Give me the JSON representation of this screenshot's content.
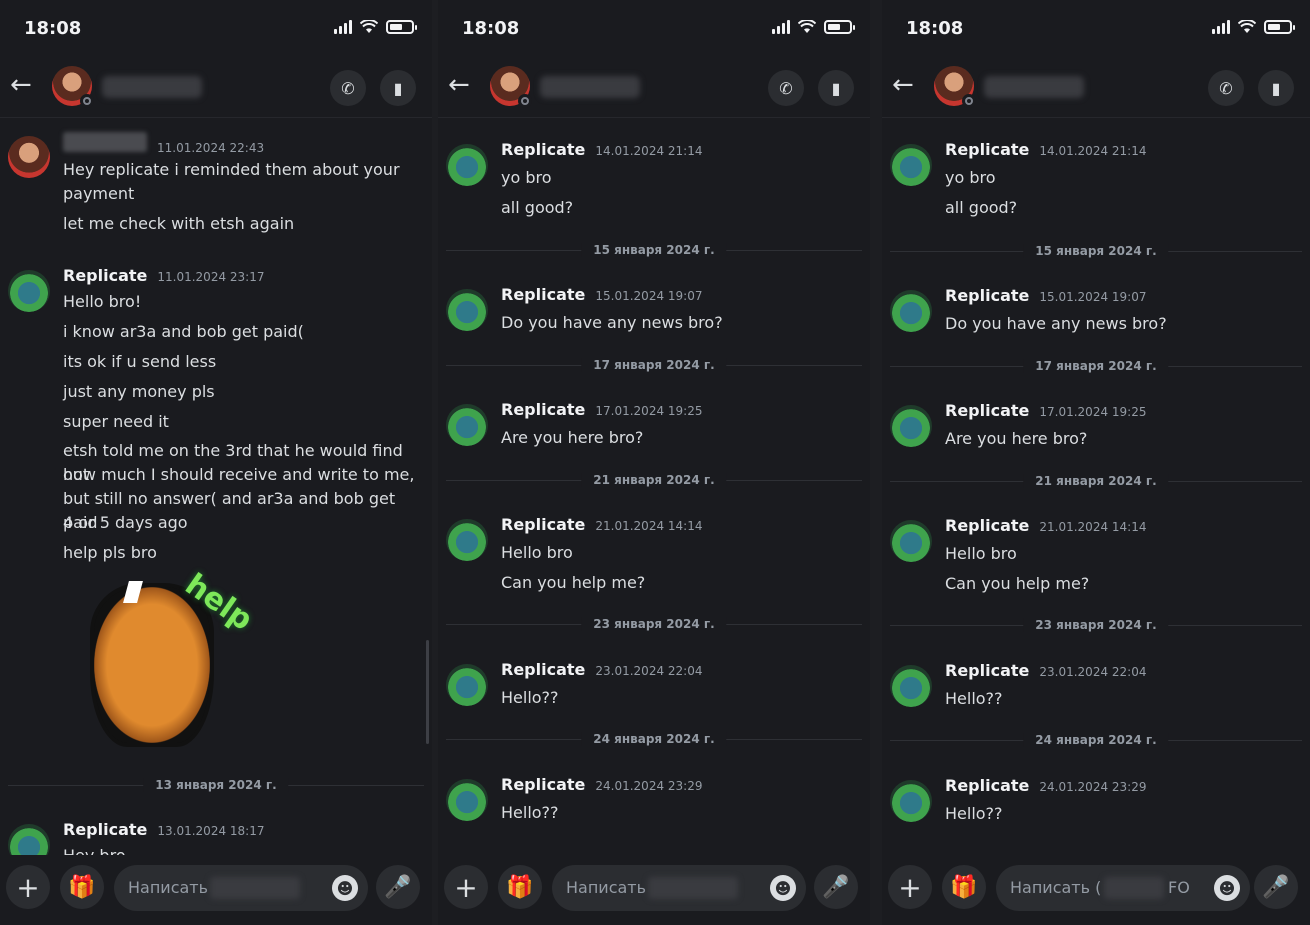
{
  "status_time": "18:08",
  "panel0": {
    "messages": [
      {
        "author": "",
        "timestamp": "11.01.2024 22:43",
        "lines": [
          "Hey replicate i reminded them about your",
          "payment",
          "let me check with etsh again"
        ]
      },
      {
        "author": "Replicate",
        "timestamp": "11.01.2024 23:17",
        "lines": [
          "Hello bro!",
          "i know ar3a and bob get paid(",
          "its ok if u send less",
          "just any money pls",
          "super need it",
          "etsh told me on the 3rd that he would find out",
          "how much I should receive and write to me,",
          "but still no answer( and ar3a and bob get paid",
          "4 or 5 days ago",
          "help pls bro"
        ]
      },
      {
        "author": "Replicate",
        "timestamp": "13.01.2024 18:17",
        "lines": [
          "Hey bro"
        ]
      }
    ],
    "sticker_text": "help",
    "divider": "13 января 2024 г.",
    "composer_placeholder": "Написать"
  },
  "panel1": {
    "messages": [
      {
        "author": "Replicate",
        "timestamp": "14.01.2024 21:14",
        "lines": [
          "yo bro",
          "all good?"
        ]
      },
      {
        "author": "Replicate",
        "timestamp": "15.01.2024 19:07",
        "lines": [
          "Do you have any news bro?"
        ]
      },
      {
        "author": "Replicate",
        "timestamp": "17.01.2024 19:25",
        "lines": [
          "Are you here bro?"
        ]
      },
      {
        "author": "Replicate",
        "timestamp": "21.01.2024 14:14",
        "lines": [
          "Hello bro",
          "Can you help me?"
        ]
      },
      {
        "author": "Replicate",
        "timestamp": "23.01.2024 22:04",
        "lines": [
          "Hello??"
        ]
      },
      {
        "author": "Replicate",
        "timestamp": "24.01.2024 23:29",
        "lines": [
          "Hello??"
        ]
      }
    ],
    "dividers": [
      "15 января 2024 г.",
      "17 января 2024 г.",
      "21 января 2024 г.",
      "23 января 2024 г.",
      "24 января 2024 г."
    ],
    "composer_placeholder": "Написать"
  },
  "panel2": {
    "messages": [
      {
        "author": "Replicate",
        "timestamp": "14.01.2024 21:14",
        "lines": [
          "yo bro",
          "all good?"
        ]
      },
      {
        "author": "Replicate",
        "timestamp": "15.01.2024 19:07",
        "lines": [
          "Do you have any news bro?"
        ]
      },
      {
        "author": "Replicate",
        "timestamp": "17.01.2024 19:25",
        "lines": [
          "Are you here bro?"
        ]
      },
      {
        "author": "Replicate",
        "timestamp": "21.01.2024 14:14",
        "lines": [
          "Hello bro",
          "Can you help me?"
        ]
      },
      {
        "author": "Replicate",
        "timestamp": "23.01.2024 22:04",
        "lines": [
          "Hello??"
        ]
      },
      {
        "author": "Replicate",
        "timestamp": "24.01.2024 23:29",
        "lines": [
          "Hello??"
        ]
      }
    ],
    "dividers": [
      "15 января 2024 г.",
      "17 января 2024 г.",
      "21 января 2024 г.",
      "23 января 2024 г.",
      "24 января 2024 г."
    ],
    "composer_placeholder": "Написать (",
    "composer_suffix": "FO"
  },
  "icons": {
    "back": "arrow-left-icon",
    "call": "phone-icon",
    "video": "video-camera-icon",
    "plus": "plus-icon",
    "gift": "gift-icon",
    "emoji": "emoji-icon",
    "mic": "microphone-icon"
  }
}
